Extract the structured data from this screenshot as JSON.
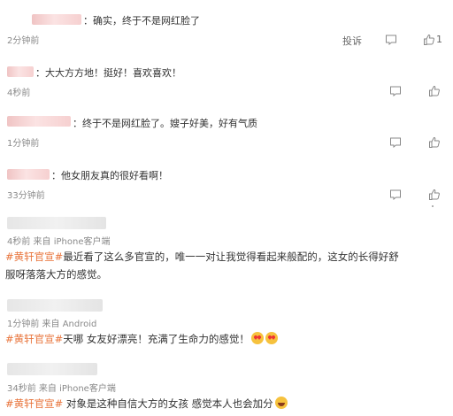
{
  "comments": [
    {
      "text": "：确实，终于不是网红脸了",
      "time": "2分钟前",
      "report": "投诉",
      "likes": "1"
    },
    {
      "text": "：大大方方地！挺好！喜欢喜欢！",
      "time": "4秒前"
    },
    {
      "text": "：终于不是网红脸了。嫂子好美，好有气质",
      "time": "1分钟前"
    },
    {
      "text": "：他女朋友真的很好看啊！",
      "time": "33分钟前"
    }
  ],
  "posts": [
    {
      "meta": "4秒前  来自 iPhone客户端",
      "tag": "#黄轩官宣#",
      "line1": "最近看了这么多官宣的，唯一一对让我觉得看起来般配的，这女的长得好舒",
      "line2": "服呀落落大方的感觉。"
    },
    {
      "meta": "1分钟前  来自 Android",
      "tag": "#黄轩官宣#",
      "line1": "天哪 女友好漂亮！充满了生命力的感觉！"
    },
    {
      "meta": "34秒前  来自 iPhone客户端",
      "tag": "#黄轩官宣#",
      "line1": " 对象是这种自信大方的女孩 感觉本人也会加分"
    }
  ],
  "icons": [
    "comment-icon",
    "thumbs-up-icon",
    "love-eyes-emoji",
    "grin-emoji"
  ],
  "colors": {
    "hashtag": "#e8733a",
    "meta": "#8a8a8a"
  }
}
